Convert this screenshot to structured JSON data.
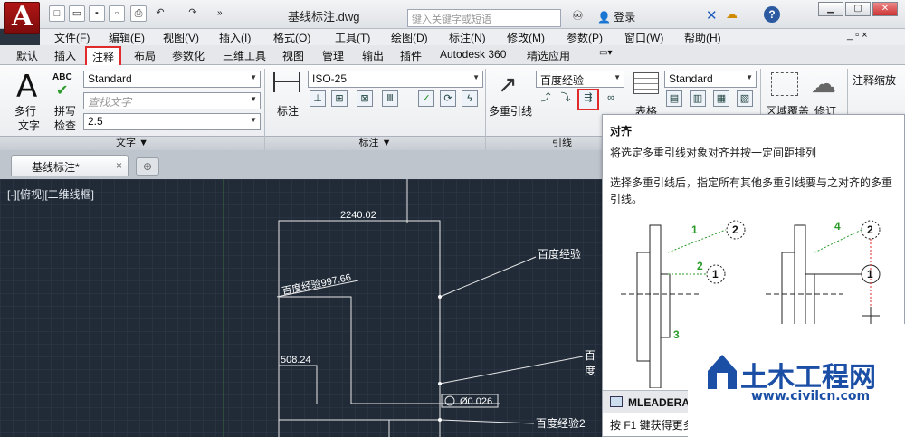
{
  "title_bar": {
    "document_title": "基线标注.dwg",
    "search_placeholder": "键入关键字或短语",
    "login_label": "登录"
  },
  "menu_bar": [
    "文件(F)",
    "编辑(E)",
    "视图(V)",
    "插入(I)",
    "格式(O)",
    "工具(T)",
    "绘图(D)",
    "标注(N)",
    "修改(M)",
    "参数(P)",
    "窗口(W)",
    "帮助(H)"
  ],
  "ribbon_tabs": [
    "默认",
    "插入",
    "注释",
    "布局",
    "参数化",
    "三维工具",
    "视图",
    "管理",
    "输出",
    "插件",
    "Autodesk 360",
    "精选应用"
  ],
  "active_tab": "注释",
  "text_panel": {
    "mtext_label1": "多行",
    "mtext_label2": "文字",
    "spell_label1": "拼写",
    "spell_label2": "检查",
    "abc": "ABC",
    "style_value": "Standard",
    "find_placeholder": "查找文字",
    "height_value": "2.5",
    "panel_title": "文字 ▼"
  },
  "dim_panel": {
    "dim_label": "标注",
    "style_value": "ISO-25",
    "panel_title": "标注 ▼"
  },
  "leader_panel": {
    "mleader_label": "多重引线",
    "style_value": "百度经验",
    "panel_title": "引线"
  },
  "table_panel": {
    "table_label": "表格",
    "style_value": "Standard"
  },
  "extra_panel": {
    "wipeout_label": "区域覆盖",
    "revcloud_label": "修订",
    "scale_label": "注释缩放"
  },
  "file_tab": {
    "name": "基线标注*"
  },
  "canvas": {
    "viewport_label": "[-][俯视][二维线框]",
    "dim_top": "2240.02",
    "dim_slant": "百度经验997.66",
    "dim_left": "508.24",
    "diameter": "Ø0.026",
    "leader1": "百度经验",
    "leader2": "百度经验2",
    "leader3": "百度"
  },
  "tooltip": {
    "title": "对齐",
    "description": "将选定多重引线对象对齐并按一定间距排列",
    "detail": "选择多重引线后，指定所有其他多重引线要与之对齐的多重引线。",
    "command": "MLEADERALIGN",
    "f1_hint": "按 F1 键获得更多帮助",
    "diagram_labels": [
      "1",
      "2",
      "2",
      "1",
      "3",
      "4",
      "2",
      "1"
    ]
  },
  "watermark": {
    "name": "土木工程网",
    "url": "www.civilcn.com"
  },
  "colors": {
    "highlight": "#e12a2a",
    "canvas_bg": "#212b38",
    "ribbon_bg": "#f2f4f6"
  }
}
